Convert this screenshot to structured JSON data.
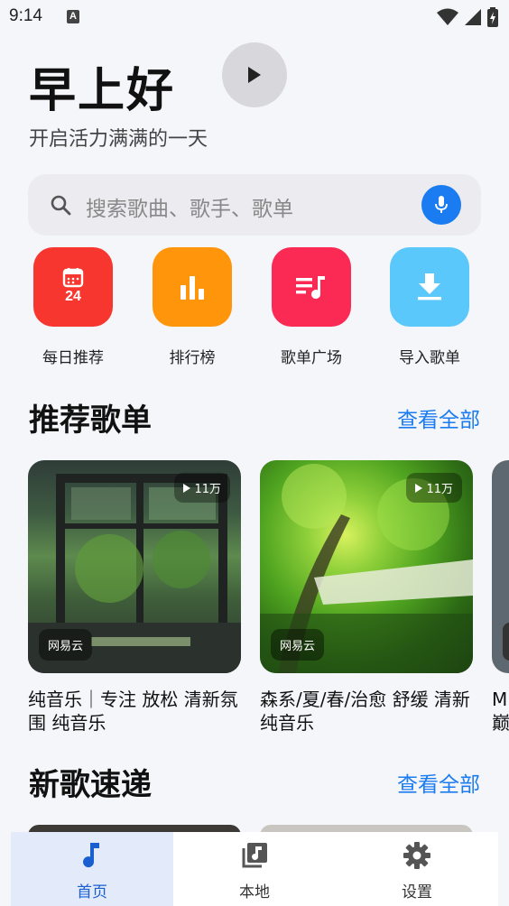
{
  "status_bar": {
    "time": "9:14",
    "notif_icon": "A"
  },
  "header": {
    "greeting": "早上好",
    "subtitle": "开启活力满满的一天"
  },
  "search": {
    "placeholder": "搜索歌曲、歌手、歌单"
  },
  "quick_actions": [
    {
      "label": "每日推荐",
      "icon": "calendar-icon",
      "color": "#f7372f",
      "badge": "24"
    },
    {
      "label": "排行榜",
      "icon": "bar-chart-icon",
      "color": "#ff950a"
    },
    {
      "label": "歌单广场",
      "icon": "playlist-icon",
      "color": "#fb2a55"
    },
    {
      "label": "导入歌单",
      "icon": "download-icon",
      "color": "#5ac8fa"
    }
  ],
  "recommended": {
    "title": "推荐歌单",
    "see_all": "查看全部",
    "playlists": [
      {
        "title": "纯音乐｜专注 放松 清新氛围 纯音乐",
        "play_count": "11万",
        "source": "网易云"
      },
      {
        "title": "森系/夏/春/治愈 舒缓 清新 纯音乐",
        "play_count": "11万",
        "source": "网易云"
      },
      {
        "title": "M\n巅"
      }
    ]
  },
  "new_songs": {
    "title": "新歌速递",
    "see_all": "查看全部"
  },
  "bottom_nav": [
    {
      "label": "首页",
      "icon": "music-note-icon",
      "active": true
    },
    {
      "label": "本地",
      "icon": "local-library-icon",
      "active": false
    },
    {
      "label": "设置",
      "icon": "gear-icon",
      "active": false
    }
  ],
  "colors": {
    "accent": "#1a7cf0",
    "background": "#f5f6fa"
  }
}
